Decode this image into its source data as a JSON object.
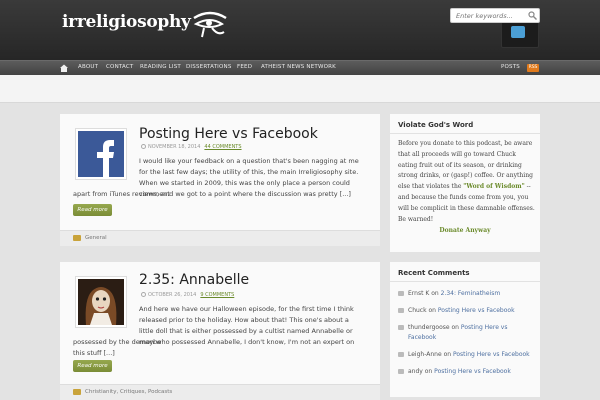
{
  "header": {
    "logo_text": "irreligiosophy",
    "logo_icon": "eye-of-horus-icon",
    "twitter_icon": "twitter-icon"
  },
  "nav": {
    "home_icon": "home-icon",
    "items": [
      "ABOUT",
      "CONTACT",
      "READING LIST",
      "DISSERTATIONS",
      "FEED",
      "ATHEIST NEWS NETWORK"
    ],
    "posts_label": "POSTS",
    "rss_label": "RSS"
  },
  "search": {
    "placeholder": "Enter keywords..."
  },
  "posts": [
    {
      "title": "Posting Here vs Facebook",
      "date": "NOVEMBER 18, 2014",
      "comments": "44 COMMENTS",
      "excerpt_1": "I would like your feedback on a question that's been nagging at me for the last few days; the utility of this, the main Irreligiosophy site. When we started in 2009, this was the only place a person could comment",
      "excerpt_2": "apart from iTunes reviews, and we got to a point where the discussion was pretty [...]",
      "read_more": "Read more",
      "categories": "General",
      "thumb_icon": "facebook-icon"
    },
    {
      "title": "2.35: Annabelle",
      "date": "OCTOBER 26, 2014",
      "comments": "9 COMMENTS",
      "excerpt_1": "And here we have our Halloween episode, for the first time I think released prior to the holiday. How about that! This one's about a little doll that is either possessed by a cultist named Annabelle or maybe",
      "excerpt_2": "possessed by the demon who possessed Annabelle, I don't know, I'm not an expert on this stuff [...]",
      "read_more": "Read more",
      "categories": "Christianity, Critiques, Podcasts",
      "thumb_icon": "annabelle-doll-image"
    }
  ],
  "sidebar": {
    "violate": {
      "title": "Violate God's Word",
      "text_1": "Before you donate to this podcast, be aware that all proceeds will go toward Chuck eating fruit out of its season, or drinking strong drinks, or (gasp!) coffee. Or anything else that violates the ",
      "word": "\"Word of Wisdom\"",
      "text_2": " -- and because the funds come from you, you will be complicit in these damnable offenses. Be warned!",
      "donate": "Donate Anyway"
    },
    "recent_comments": {
      "title": "Recent Comments",
      "items": [
        {
          "author": "Ernst K",
          "on": "on",
          "post": "2.34: Feminatheism"
        },
        {
          "author": "Chuck",
          "on": "on",
          "post": "Posting Here vs Facebook"
        },
        {
          "author": "thundergoose",
          "on": "on",
          "post": "Posting Here vs Facebook"
        },
        {
          "author": "Leigh-Anne",
          "on": "on",
          "post": "Posting Here vs Facebook"
        },
        {
          "author": "andy",
          "on": "on",
          "post": "Posting Here vs Facebook"
        }
      ]
    }
  },
  "colors": {
    "accent_green": "#7a8c36",
    "link_blue": "#4d6fa0",
    "header_dark": "#2a2a2a"
  }
}
